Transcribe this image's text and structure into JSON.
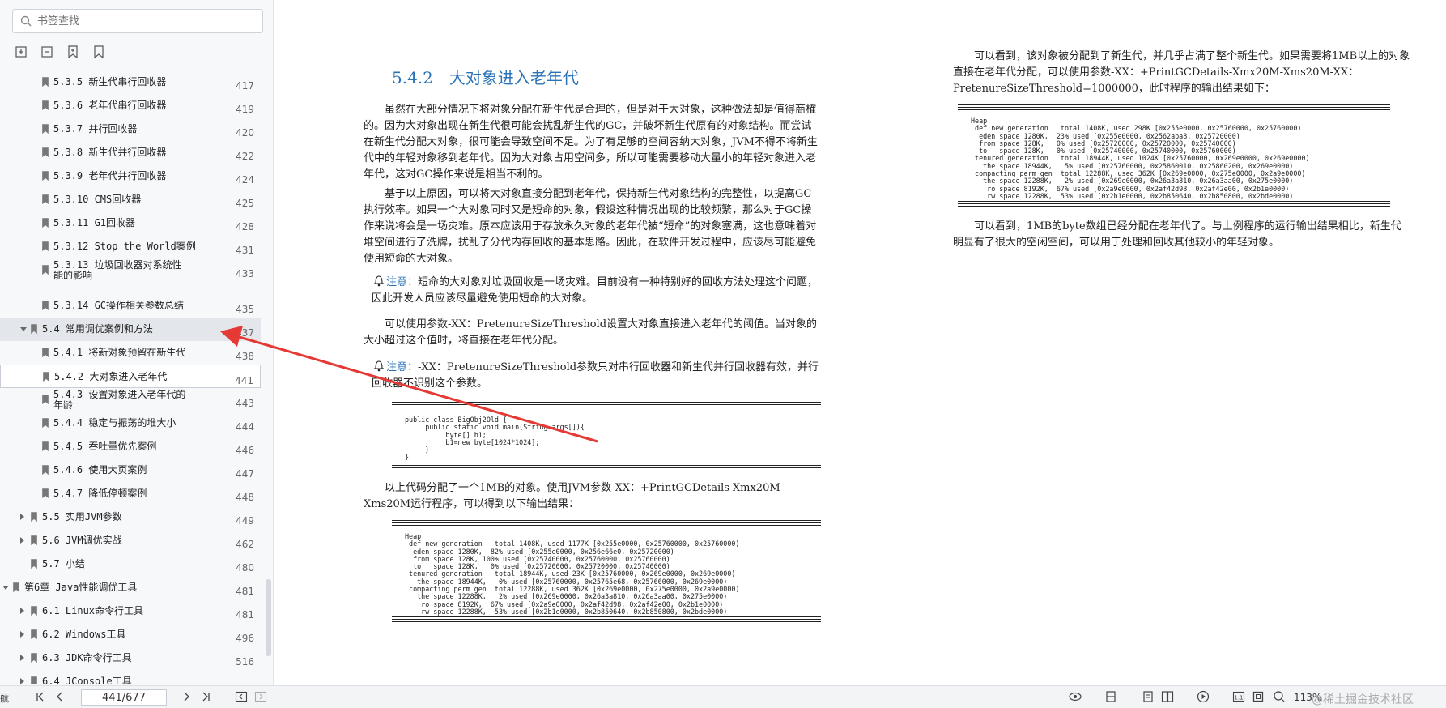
{
  "search": {
    "placeholder": "书签查找"
  },
  "toolbar_icons": [
    "expand-all-icon",
    "collapse-all-icon",
    "add-bookmark-icon",
    "bookmark-icon"
  ],
  "bookmarks": [
    {
      "label": "5.3.5 新生代串行回收器",
      "page": "417"
    },
    {
      "label": "5.3.6 老年代串行回收器",
      "page": "419"
    },
    {
      "label": "5.3.7 并行回收器",
      "page": "420"
    },
    {
      "label": "5.3.8 新生代并行回收器",
      "page": "422"
    },
    {
      "label": "5.3.9 老年代并行回收器",
      "page": "424"
    },
    {
      "label": "5.3.10 CMS回收器",
      "page": "425"
    },
    {
      "label": "5.3.11 G1回收器",
      "page": "428"
    },
    {
      "label": "5.3.12 Stop the World案例",
      "page": "431"
    },
    {
      "label": "5.3.13 垃圾回收器对系统性能的影响",
      "page": "433"
    },
    {
      "label": "5.3.14 GC操作相关参数总结",
      "page": "435"
    },
    {
      "label": "5.4 常用调优案例和方法",
      "page": "437"
    },
    {
      "label": "5.4.1 将新对象预留在新生代",
      "page": "438"
    },
    {
      "label": "5.4.2 大对象进入老年代",
      "page": "441"
    },
    {
      "label": "5.4.3 设置对象进入老年代的年龄",
      "page": "443"
    },
    {
      "label": "5.4.4 稳定与振荡的堆大小",
      "page": "444"
    },
    {
      "label": "5.4.5 吞吐量优先案例",
      "page": "446"
    },
    {
      "label": "5.4.6 使用大页案例",
      "page": "447"
    },
    {
      "label": "5.4.7 降低停顿案例",
      "page": "448"
    },
    {
      "label": "5.5 实用JVM参数",
      "page": "449"
    },
    {
      "label": "5.6 JVM调优实战",
      "page": "462"
    },
    {
      "label": "5.7 小结",
      "page": "480"
    },
    {
      "label": "第6章 Java性能调优工具",
      "page": "481"
    },
    {
      "label": "6.1 Linux命令行工具",
      "page": "481"
    },
    {
      "label": "6.2 Windows工具",
      "page": "496"
    },
    {
      "label": "6.3 JDK命令行工具",
      "page": "516"
    },
    {
      "label": "6.4 JConsole工具",
      "page": ""
    }
  ],
  "doc": {
    "section_number": "5.4.2",
    "section_title": "大对象进入老年代",
    "p1": "虽然在大部分情况下将对象分配在新生代是合理的，但是对于大对象，这种做法却是值得商榷的。因为大对象出现在新生代很可能会扰乱新生代的GC，并破坏新生代原有的对象结构。而尝试在新生代分配大对象，很可能会导致空间不足。为了有足够的空间容纳大对象，JVM不得不将新生代中的年轻对象移到老年代。因为大对象占用空间多，所以可能需要移动大量小的年轻对象进入老年代，这对GC操作来说是相当不利的。",
    "p2": "基于以上原因，可以将大对象直接分配到老年代，保持新生代对象结构的完整性，以提高GC执行效率。如果一个大对象同时又是短命的对象，假设这种情况出现的比较频繁，那么对于GC操作来说将会是一场灾难。原本应该用于存放永久对象的老年代被“短命”的对象塞满，这也意味着对堆空间进行了洗牌，扰乱了分代内存回收的基本思路。因此，在软件开发过程中，应该尽可能避免使用短命的大对象。",
    "note_word": "注意：",
    "note1": "短命的大对象对垃圾回收是一场灾难。目前没有一种特别好的回收方法处理这个问题，因此开发人员应该尽量避免使用短命的大对象。",
    "p3": "可以使用参数-XX：PretenureSizeThreshold设置大对象直接进入老年代的阈值。当对象的大小超过这个值时，将直接在老年代分配。",
    "note2": "-XX：PretenureSizeThreshold参数只对串行回收器和新生代并行回收器有效，并行回收器不识别这个参数。",
    "code1": "public class BigObj2Old {\n     public static void main(String args[]){\n          byte[] b1;\n          b1=new byte[1024*1024];\n     }\n}",
    "p4": "以上代码分配了一个1MB的对象。使用JVM参数-XX：+PrintGCDetails-Xmx20M-Xms20M运行程序，可以得到以下输出结果：",
    "code2": "Heap\n def new generation   total 1408K, used 1177K [0x255e0000, 0x25760000, 0x25760000)\n  eden space 1280K,  82% used [0x255e0000, 0x256e66e0, 0x25720000)\n  from space 128K, 100% used [0x25740000, 0x25760000, 0x25760000)\n  to   space 128K,   0% used [0x25720000, 0x25720000, 0x25740000)\n tenured generation   total 18944K, used 23K [0x25760000, 0x269e0000, 0x269e0000)\n   the space 18944K,   0% used [0x25760000, 0x25765e68, 0x25766000, 0x269e0000)\n compacting perm gen  total 12288K, used 362K [0x269e0000, 0x275e0000, 0x2a9e0000)\n   the space 12288K,   2% used [0x269e0000, 0x26a3a810, 0x26a3aa00, 0x275e0000)\n    ro space 8192K,  67% used [0x2a9e0000, 0x2af42d98, 0x2af42e00, 0x2b1e0000)\n    rw space 12288K,  53% used [0x2b1e0000, 0x2b850640, 0x2b850800, 0x2bde0000)",
    "r1": "可以看到，该对象被分配到了新生代，并几乎占满了整个新生代。如果需要将1MB以上的对象直接在老年代分配，可以使用参数-XX：+PrintGCDetails-Xmx20M-Xms20M-XX：PretenureSizeThreshold=1000000，此时程序的输出结果如下：",
    "code3": "Heap\n def new generation   total 1408K, used 298K [0x255e0000, 0x25760000, 0x25760000)\n  eden space 1280K,  23% used [0x255e0000, 0x2562aba8, 0x25720000)\n  from space 128K,   0% used [0x25720000, 0x25720000, 0x25740000)\n  to   space 128K,   0% used [0x25740000, 0x25740000, 0x25760000)\n tenured generation   total 18944K, used 1024K [0x25760000, 0x269e0000, 0x269e0000)\n   the space 18944K,   5% used [0x25760000, 0x25860010, 0x25860200, 0x269e0000)\n compacting perm gen  total 12288K, used 362K [0x269e0000, 0x275e0000, 0x2a9e0000)\n   the space 12288K,   2% used [0x269e0000, 0x26a3a810, 0x26a3aa00, 0x275e0000)\n    ro space 8192K,  67% used [0x2a9e0000, 0x2af42d98, 0x2af42e00, 0x2b1e0000)\n    rw space 12288K,  53% used [0x2b1e0000, 0x2b850640, 0x2b850800, 0x2bde0000)",
    "r2": "可以看到，1MB的byte数组已经分配在老年代了。与上例程序的运行输出结果相比，新生代明显有了很大的空闲空间，可以用于处理和回收其他较小的年轻对象。"
  },
  "statusbar": {
    "nav_label": "航",
    "page_value": "441/677",
    "zoom": "113%",
    "watermark": "@稀土掘金技术社区"
  },
  "colors": {
    "heading": "#2b73b8",
    "arrow": "#e53935"
  }
}
